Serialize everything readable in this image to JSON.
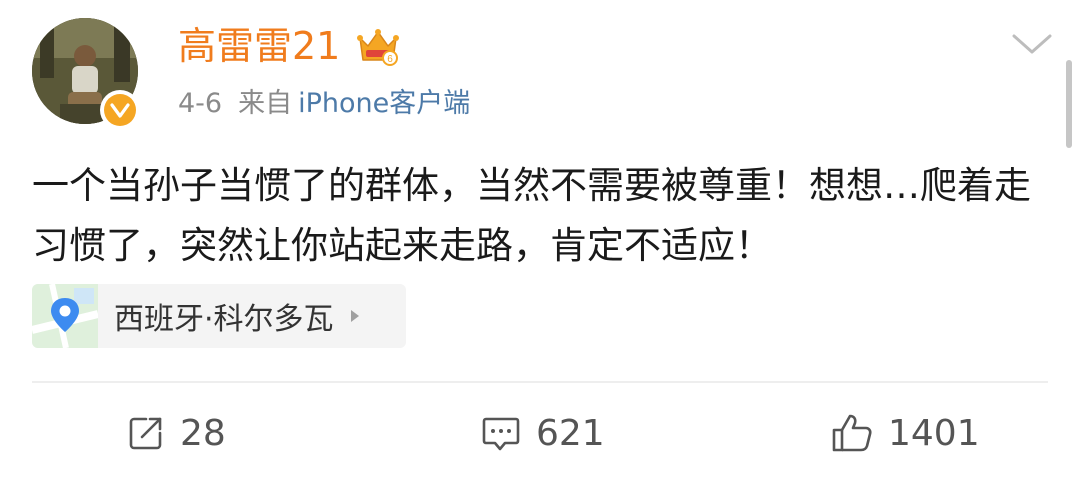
{
  "post": {
    "author": {
      "name": "高雷雷21",
      "icon_crown": "crown-vip-icon",
      "icon_verified": "verified-badge-icon"
    },
    "meta": {
      "date": "4-6",
      "from_label": "来自",
      "source": "iPhone客户端"
    },
    "content": "一个当孙子当惯了的群体，当然不需要被尊重！想想…爬着走习惯了，突然让你站起来走路，肯定不适应！",
    "location": {
      "label": "西班牙·科尔多瓦",
      "icon": "map-pin-icon"
    },
    "actions": {
      "repost": {
        "icon": "share-icon",
        "count": "28"
      },
      "comment": {
        "icon": "comment-icon",
        "count": "621"
      },
      "like": {
        "icon": "thumbs-up-icon",
        "count": "1401"
      }
    },
    "colors": {
      "username": "#f07c1d",
      "source_link": "#4d7aa8",
      "verified": "#f5a623",
      "meta_gray": "#8a8a8a"
    }
  }
}
